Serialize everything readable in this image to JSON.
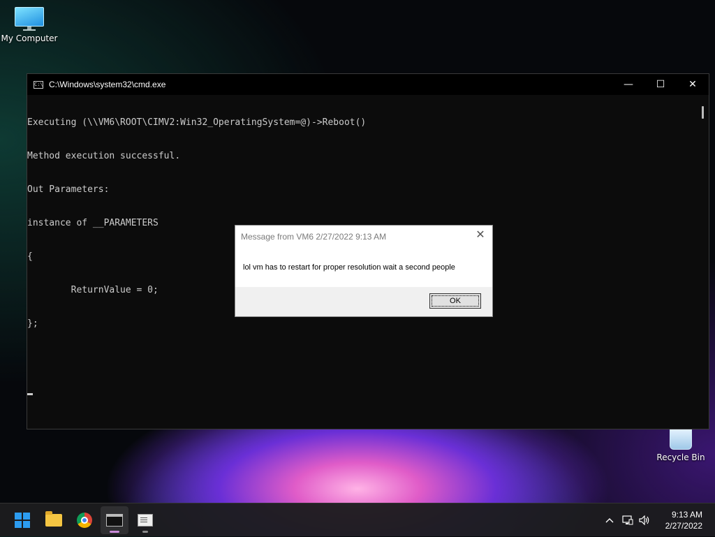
{
  "desktop": {
    "icons": [
      {
        "label": "My Computer",
        "icon": "computer-icon"
      },
      {
        "label": "Recycle Bin",
        "icon": "recycle-bin-icon"
      }
    ]
  },
  "cmd": {
    "title": "C:\\Windows\\system32\\cmd.exe",
    "lines": [
      "Executing (\\\\VM6\\ROOT\\CIMV2:Win32_OperatingSystem=@)->Reboot()",
      "Method execution successful.",
      "Out Parameters:",
      "instance of __PARAMETERS",
      "{",
      "        ReturnValue = 0;",
      "};"
    ],
    "controls": {
      "minimize": "—",
      "maximize": "☐",
      "close": "✕"
    }
  },
  "dialog": {
    "title": "Message from VM6 2/27/2022 9:13 AM",
    "message": "lol vm has to restart for proper resolution wait a second people",
    "ok_label": "OK",
    "close_glyph": "✕"
  },
  "taskbar": {
    "apps": [
      {
        "name": "start",
        "icon": "windows-logo-icon",
        "active": false
      },
      {
        "name": "file-explorer",
        "icon": "folder-icon",
        "active": false
      },
      {
        "name": "chrome",
        "icon": "chrome-icon",
        "active": false
      },
      {
        "name": "command-prompt",
        "icon": "cmd-icon",
        "active": true
      },
      {
        "name": "notepad",
        "icon": "notepad-icon",
        "active": false
      }
    ],
    "tray": {
      "chevron": "^",
      "network": "network-icon",
      "volume": "volume-icon"
    },
    "clock": {
      "time": "9:13 AM",
      "date": "2/27/2022"
    }
  }
}
